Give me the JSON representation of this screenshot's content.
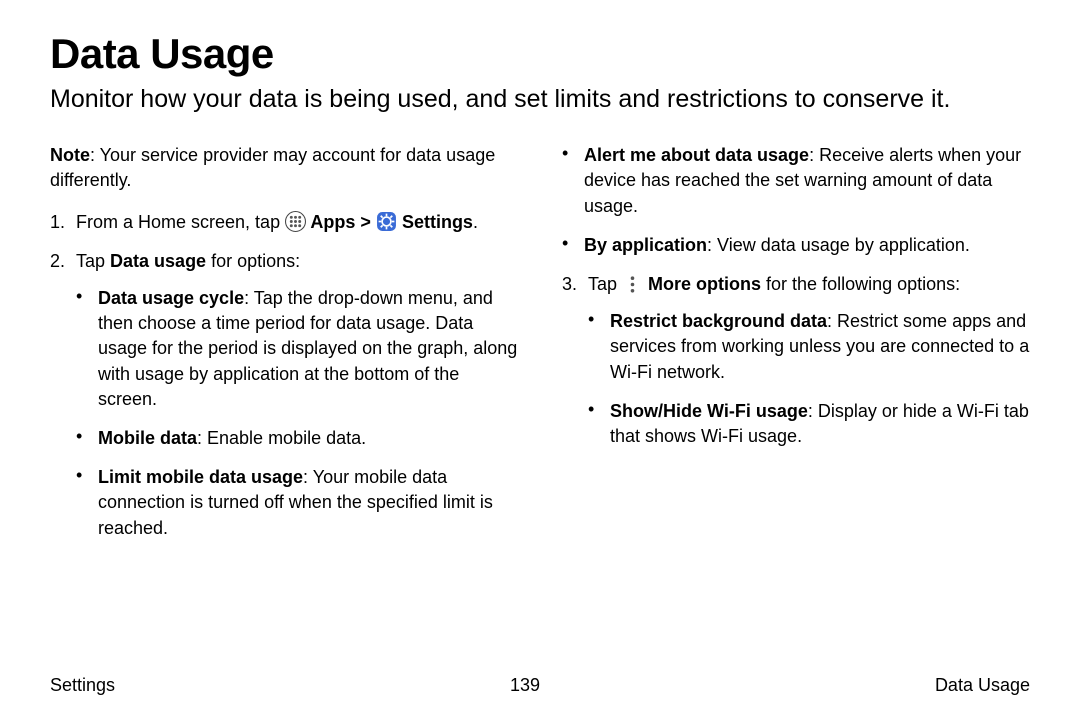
{
  "title": "Data Usage",
  "subtitle": "Monitor how your data is being used, and set limits and restrictions to conserve it.",
  "note_label": "Note",
  "note_text": ": Your service provider may account for data usage differently.",
  "step1_num": "1.",
  "step1_a": "From a Home screen, tap ",
  "step1_apps": " Apps > ",
  "step1_settings": " Settings",
  "step1_end": ".",
  "step2_num": "2.",
  "step2_a": "Tap ",
  "step2_b": "Data usage",
  "step2_c": " for options:",
  "b_cycle_t": "Data usage cycle",
  "b_cycle_d": ": Tap the drop-down menu, and then choose a time period for data usage. Data usage for the period is displayed on the graph, along with usage by application at the bottom of the screen.",
  "b_mobile_t": "Mobile data",
  "b_mobile_d": ": Enable mobile data.",
  "b_limit_t": "Limit mobile data usage",
  "b_limit_d": ": Your mobile data connection is turned off when the specified limit is reached.",
  "b_alert_t": "Alert me about data usage",
  "b_alert_d": ": Receive alerts when your device has reached the set warning amount of data usage.",
  "b_app_t": "By application",
  "b_app_d": ": View data usage by application.",
  "step3_num": "3.",
  "step3_a": "Tap ",
  "step3_b": " More options",
  "step3_c": " for the following options:",
  "b_restrict_t": "Restrict background data",
  "b_restrict_d": ": Restrict some apps and services from working unless you are connected to a Wi-Fi network.",
  "b_wifi_t": "Show/Hide Wi-Fi usage",
  "b_wifi_d": ": Display or hide a Wi-Fi tab that shows Wi-Fi usage.",
  "footer_left": "Settings",
  "footer_center": "139",
  "footer_right": "Data Usage"
}
